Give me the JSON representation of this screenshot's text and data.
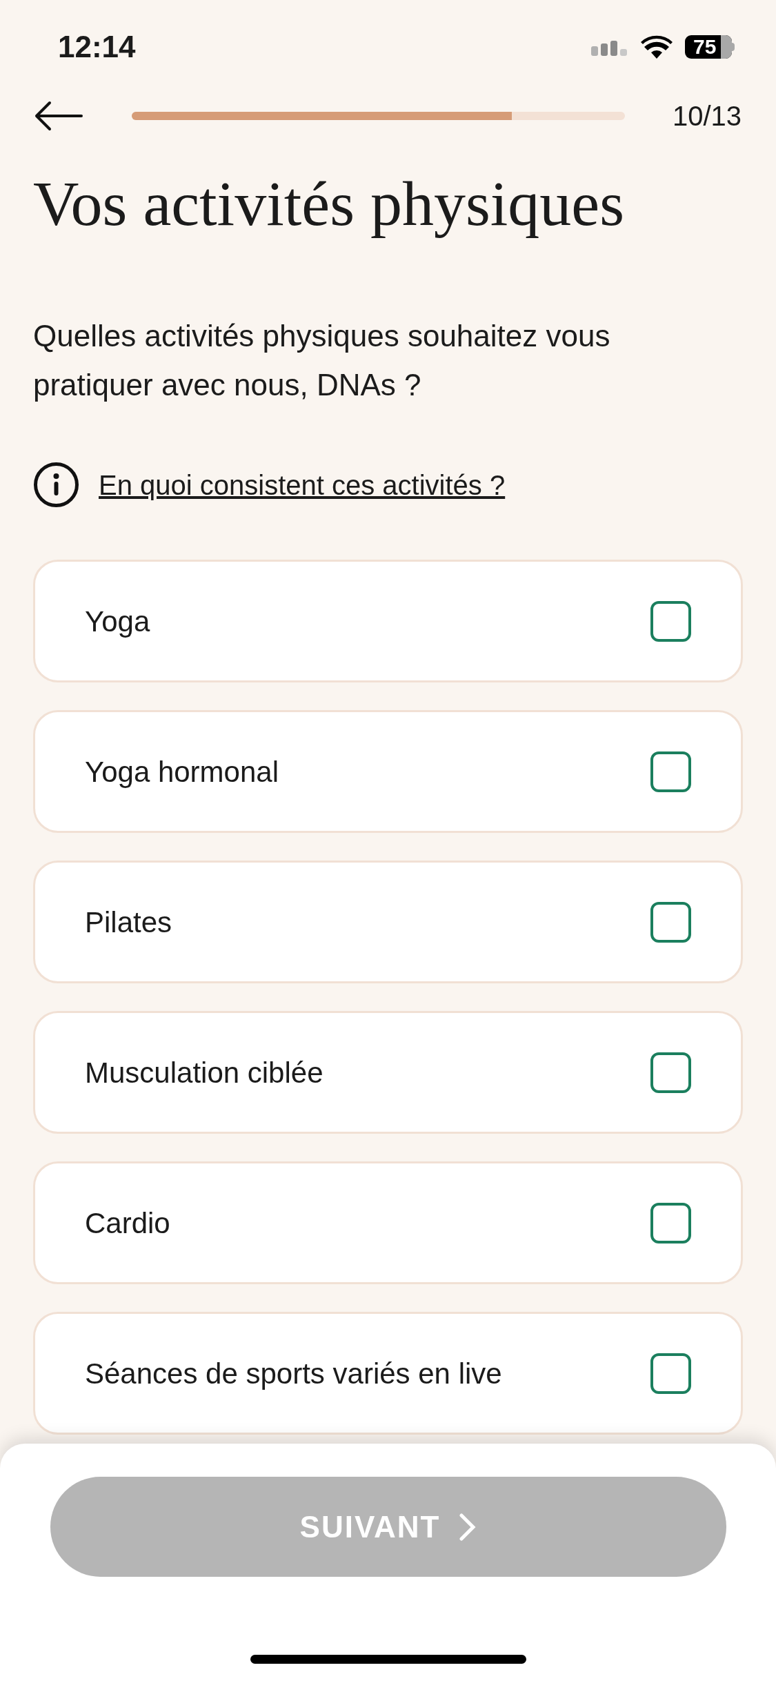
{
  "status_bar": {
    "time": "12:14",
    "battery": "75"
  },
  "header": {
    "progress": {
      "level": 0.77
    },
    "step": "10/13"
  },
  "title": "Vos activités physiques",
  "question": "Quelles activités physiques souhaitez vous pratiquer avec nous, DNAs ?",
  "info_link": "En quoi consistent ces activités ?",
  "options": [
    {
      "label": "Yoga",
      "checked": false
    },
    {
      "label": "Yoga hormonal",
      "checked": false
    },
    {
      "label": "Pilates",
      "checked": false
    },
    {
      "label": "Musculation ciblée",
      "checked": false
    },
    {
      "label": "Cardio",
      "checked": false
    },
    {
      "label": "Séances de sports variés en live",
      "checked": false
    }
  ],
  "next_button": {
    "label": "SUIVANT",
    "disabled": true
  }
}
